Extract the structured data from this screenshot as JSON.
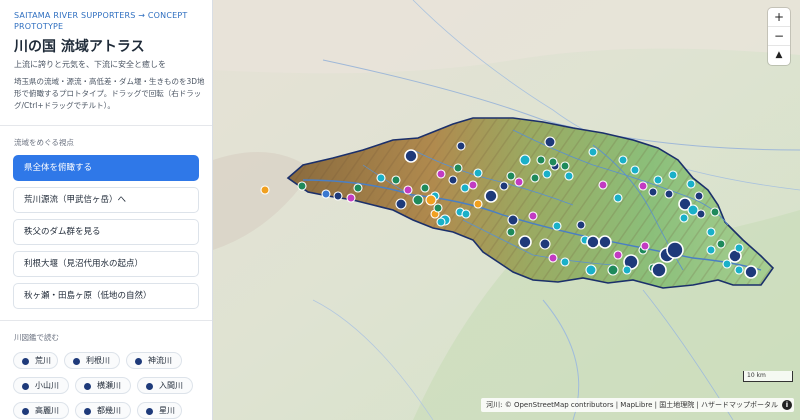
{
  "header": {
    "eyebrow": "SAITAMA RIVER SUPPORTERS → CONCEPT PROTOTYPE",
    "title": "川の国 流域アトラス",
    "subtitle": "上流に誇りと元気を、下流に安全と癒しを",
    "description": "埼玉県の流域・源流・高低差・ダム堰・生きものを3D地形で俯瞰するプロトタイプ。ドラッグで回転（右ドラッグ/Ctrl+ドラッグでチルト）。"
  },
  "views": {
    "section_label": "流域をめぐる視点",
    "buttons": [
      {
        "label": "県全体を俯瞰する",
        "active": true
      },
      {
        "label": "荒川源流（甲武信ヶ岳）へ",
        "active": false
      },
      {
        "label": "秩父のダム群を見る",
        "active": false
      },
      {
        "label": "利根大堰（見沼代用水の起点）",
        "active": false
      },
      {
        "label": "秋ヶ瀬・田島ヶ原（低地の自然）",
        "active": false
      }
    ]
  },
  "rivers": {
    "section_label": "川図鑑で読む",
    "items": [
      "荒川",
      "利根川",
      "神流川",
      "小山川",
      "横瀬川",
      "入間川",
      "高麗川",
      "都幾川",
      "星川"
    ]
  },
  "map": {
    "zoom_in": "+",
    "zoom_out": "−",
    "compass": "▲",
    "scale_label": "10 km",
    "attribution": "河川: © OpenStreetMap contributors | MapLibre | 国土地理院 | ハザードマップポータル",
    "info": "i",
    "colors": {
      "basin_outline": "#1a2f6b",
      "poi_navy": "#1e3a7a",
      "poi_green": "#1f8a5b",
      "poi_cyan": "#1ab0c8",
      "poi_magenta": "#c23bc2",
      "poi_orange": "#f0a020",
      "poi_blue": "#3a78d0"
    }
  }
}
